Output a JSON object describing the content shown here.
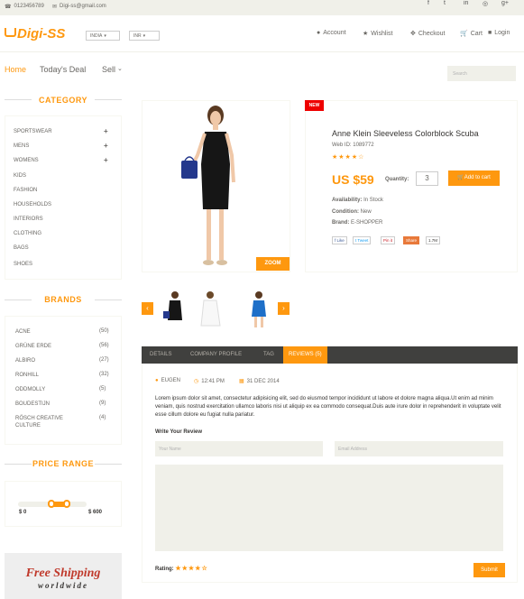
{
  "topbar": {
    "phone": "0123456789",
    "email": "Digi-ss@gmail.com",
    "social": [
      "f",
      "t",
      "in",
      "◎",
      "g+"
    ]
  },
  "header": {
    "logo": "Digi-SS",
    "country": "INDIA",
    "currency": "INR",
    "links": {
      "account": "Account",
      "wishlist": "Wishlist",
      "checkout": "Checkout",
      "cart": "Cart",
      "login": "Login"
    }
  },
  "nav": {
    "home": "Home",
    "deal": "Today's Deal",
    "sell": "Sell",
    "search_placeholder": "Search"
  },
  "sidebar": {
    "category_title": "CATEGORY",
    "categories": [
      {
        "label": "SPORTSWEAR",
        "expand": "+"
      },
      {
        "label": "MENS",
        "expand": "+"
      },
      {
        "label": "WOMENS",
        "expand": "+"
      },
      {
        "label": "KIDS"
      },
      {
        "label": "FASHION"
      },
      {
        "label": "HOUSEHOLDS"
      },
      {
        "label": "INTERIORS"
      },
      {
        "label": "CLOTHING"
      },
      {
        "label": "BAGS"
      },
      {
        "label": "SHOES"
      }
    ],
    "brands_title": "BRANDS",
    "brands": [
      {
        "name": "ACNE",
        "count": "(50)"
      },
      {
        "name": "GRÜNE ERDE",
        "count": "(56)"
      },
      {
        "name": "ALBIRO",
        "count": "(27)"
      },
      {
        "name": "RONHILL",
        "count": "(32)"
      },
      {
        "name": "ODDMOLLY",
        "count": "(5)"
      },
      {
        "name": "BOUDESTIJN",
        "count": "(9)"
      },
      {
        "name": "RÖSCH CREATIVE CULTURE",
        "count": "(4)"
      }
    ],
    "price_title": "PRICE RANGE",
    "price_min": "$ 0",
    "price_max": "$ 600",
    "shipping_line1": "Free Shipping",
    "shipping_line2": "worldwide"
  },
  "product": {
    "badge": "NEW",
    "title": "Anne Klein Sleeveless Colorblock Scuba",
    "web_id": "Web ID: 1089772",
    "stars": "★★★★☆",
    "price": "US $59",
    "quantity_label": "Quantity:",
    "quantity": "3",
    "add_to_cart": "Add to cart",
    "availability_label": "Availability:",
    "availability": "In Stock",
    "condition_label": "Condition:",
    "condition": "New",
    "brand_label": "Brand:",
    "brand": "E-SHOPPER",
    "zoom": "ZOOM",
    "share": {
      "like": "Like",
      "tweet": "Tweet",
      "pin": "Pin it",
      "share": "Share",
      "count": "1.7M"
    }
  },
  "tabs": {
    "items": [
      "DETAILS",
      "COMPANY PROFILE",
      "TAG",
      "REVIEWS (5)"
    ],
    "review": {
      "author": "EUGEN",
      "time": "12:41 PM",
      "date": "31 DEC 2014",
      "text": "Lorem ipsum dolor sit amet, consectetur adipisicing elit, sed do eiusmod tempor incididunt ut labore et dolore magna aliqua.Ut enim ad minim veniam, quis nostrud exercitation ullamco laboris nisi ut aliquip ex ea commodo consequat.Duis aute irure dolor in reprehenderit in voluptate velit esse cillum dolore eu fugiat nulla pariatur.",
      "write_title": "Write Your Review",
      "name_placeholder": "Your Name",
      "email_placeholder": "Email Address",
      "rating_label": "Rating:",
      "rating_stars": "★★★★☆",
      "submit": "Submit"
    }
  },
  "colors": {
    "accent": "#FE980F",
    "dark": "#40403e",
    "light": "#f0f0e9"
  }
}
